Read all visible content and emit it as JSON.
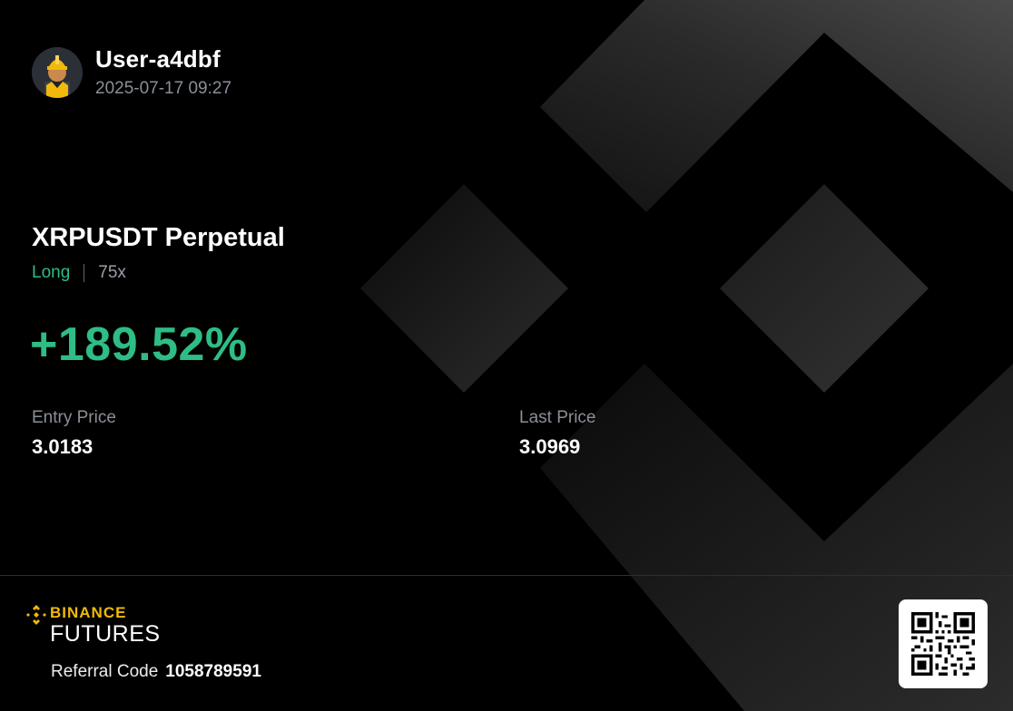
{
  "user": {
    "name": "User-a4dbf",
    "timestamp": "2025-07-17 09:27"
  },
  "position": {
    "symbol": "XRPUSDT Perpetual",
    "side": "Long",
    "leverage": "75x",
    "pnl_percent": "+189.52%"
  },
  "prices": {
    "entry_label": "Entry Price",
    "entry_value": "3.0183",
    "last_label": "Last Price",
    "last_value": "3.0969"
  },
  "brand": {
    "name": "BINANCE",
    "product": "FUTURES"
  },
  "referral": {
    "label": "Referral Code",
    "code": "1058789591"
  },
  "icons": {
    "avatar": "worker-hardhat-avatar",
    "brand_logo": "binance-diamond-logo",
    "qr": "qr-code"
  },
  "colors": {
    "background": "#000000",
    "profit_green": "#2ebd85",
    "brand_yellow": "#f0b90b",
    "muted_text": "#8a8f98"
  }
}
